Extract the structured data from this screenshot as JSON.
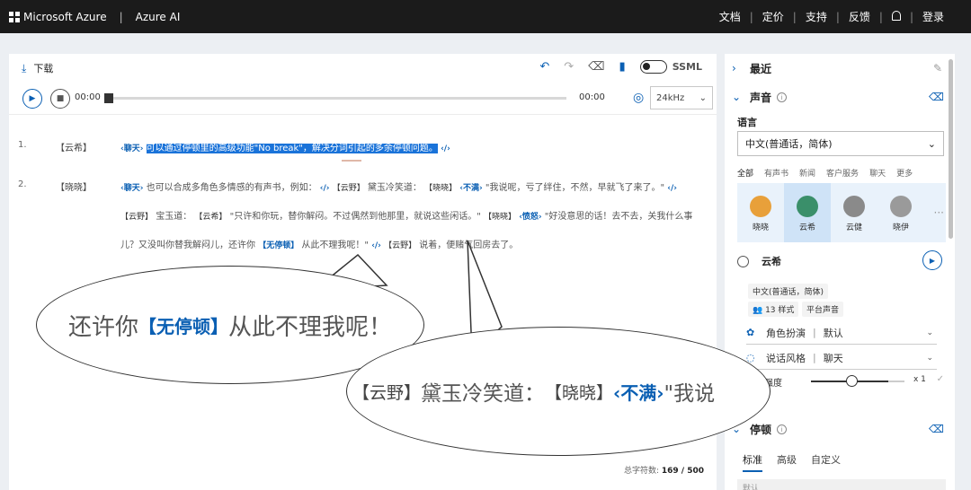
{
  "topbar": {
    "brand": "Microsoft Azure",
    "product": "Azure AI",
    "nav": [
      "文档",
      "定价",
      "支持",
      "反馈"
    ],
    "login": "登录",
    "separator": "|"
  },
  "toolbar": {
    "download_label": "下载",
    "ssml_label": "SSML"
  },
  "player": {
    "time_start": "00:00",
    "time_end": "00:00",
    "sample_rate": "24kHz"
  },
  "editor": {
    "lines": [
      {
        "num": "1.",
        "speaker": "【云希】",
        "tag": "‹聊天›",
        "text": "可以通过停顿里的高级功能\"No break\"，解决分词引起的多余停顿问题。",
        "end_tag": "‹/›"
      },
      {
        "num": "2.",
        "speaker": "【晓晓】",
        "tag1": "‹聊天›",
        "part1": "也可以合成多角色多情感的有声书，例如：",
        "end1": "‹/›",
        "role1": "【云野】",
        "part2": "黛玉冷笑道：",
        "role2": "【晓晓】",
        "tag2": "‹不满›",
        "part3": "\"我说呢，亏了绊住，不然，早就飞了来了。\"",
        "end2": "‹/›",
        "role3": "【云野】",
        "part4": "宝玉道：",
        "role4": "【云希】",
        "part5": "\"只许和你玩，替你解闷。不过偶然到他那里，就说这些闲话。\"",
        "role5": "【晓晓】",
        "tag3": "‹愤怒›",
        "part6": "\"好没意思的话！去不去，关我什么事儿？又没叫你替我解闷儿，还许你",
        "tag4": "【无停顿】",
        "part7": "从此不理我呢！\"",
        "end3": "‹/›",
        "role6": "【云野】",
        "part8": "说着，便赌气回房去了。"
      }
    ],
    "count_label": "总字符数:",
    "count_value": "169 / 500"
  },
  "bubbles": {
    "b1_text1": "还许你",
    "b1_tag": "【无停顿】",
    "b1_text2": "从此不理我呢！",
    "b2_role1": "【云野】",
    "b2_text1": "黛玉冷笑道：",
    "b2_role2": "【晓晓】",
    "b2_tag": "‹不满›",
    "b2_text2": "\"我说"
  },
  "sidebar": {
    "recent_title": "最近",
    "voice_title": "声音",
    "language_label": "语言",
    "language_value": "中文(普通话，简体)",
    "categories": [
      "全部",
      "有声书",
      "新闻",
      "客户服务",
      "聊天",
      "更多"
    ],
    "voices": [
      {
        "name": "晓晓",
        "color": "#e8a03a"
      },
      {
        "name": "云希",
        "color": "#3a8f6a"
      },
      {
        "name": "云健",
        "color": "#8a8a8a"
      },
      {
        "name": "晓伊",
        "color": "#9a9a9a"
      }
    ],
    "selected_voice": "云希",
    "chip_language": "中文(普通话，简体)",
    "chip_styles": "13 样式",
    "chip_platform": "平台声音",
    "role_label": "角色扮演",
    "role_value": "默认",
    "style_label": "说话风格",
    "style_value": "聊天",
    "intensity_label": "格强度",
    "intensity_value": "x 1",
    "intensity_fraction": 0.45,
    "pause_title": "停顿",
    "pause_tabs": [
      "标准",
      "高级",
      "自定义"
    ],
    "pause_box": "默认"
  },
  "colors": {
    "accent": "#0a5fb3",
    "highlight": "#1a73d9",
    "topbar": "#1b1b1b"
  }
}
